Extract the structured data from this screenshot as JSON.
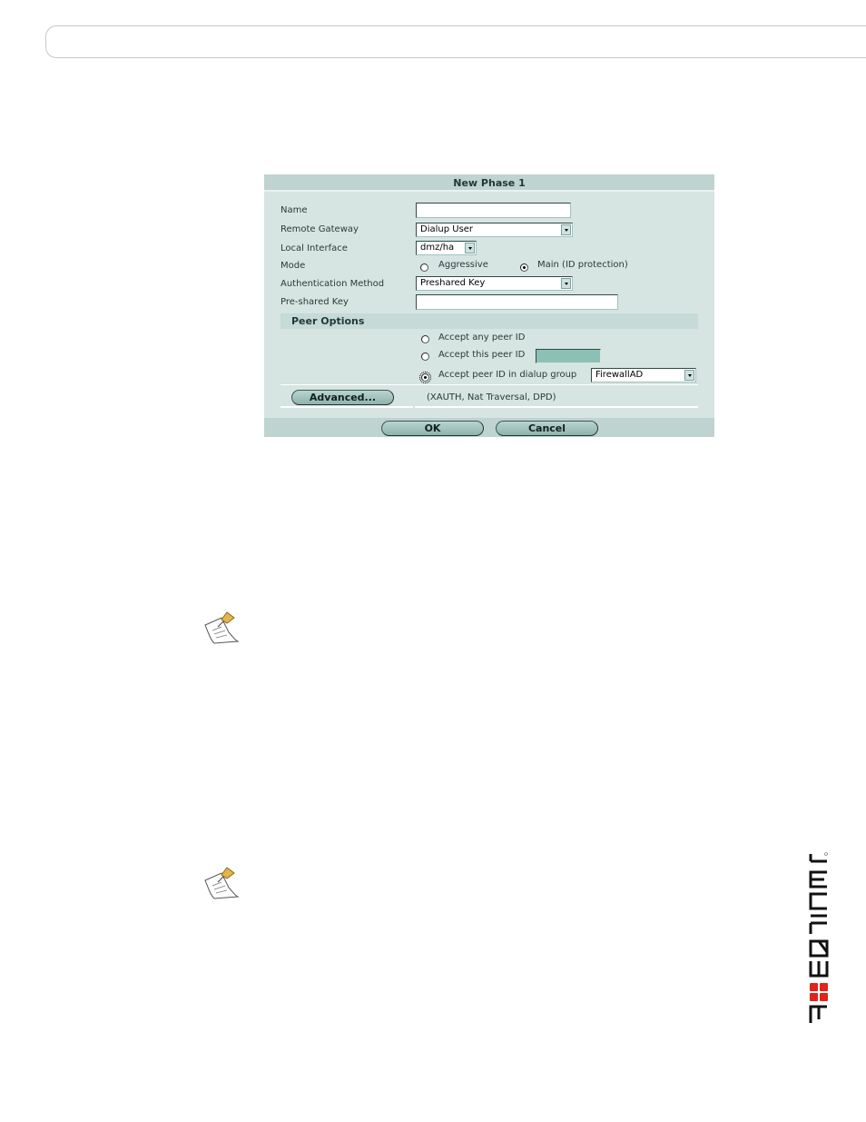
{
  "dialog": {
    "title": "New Phase 1",
    "fields": {
      "name": {
        "label": "Name",
        "value": ""
      },
      "remote_gateway": {
        "label": "Remote Gateway",
        "value": "Dialup User"
      },
      "local_interface": {
        "label": "Local Interface",
        "value": "dmz/ha"
      },
      "mode": {
        "label": "Mode",
        "options": [
          {
            "label": "Aggressive",
            "checked": false
          },
          {
            "label": "Main (ID protection)",
            "checked": true
          }
        ]
      },
      "auth_method": {
        "label": "Authentication Method",
        "value": "Preshared Key"
      },
      "preshared_key": {
        "label": "Pre-shared Key",
        "value": ""
      }
    },
    "peer_options": {
      "heading": "Peer Options",
      "options": [
        {
          "label": "Accept any peer ID",
          "checked": false
        },
        {
          "label": "Accept this peer ID",
          "checked": false,
          "value": ""
        },
        {
          "label": "Accept peer ID in dialup group",
          "checked": true,
          "group": "FirewallAD"
        }
      ]
    },
    "advanced": {
      "button_label": "Advanced...",
      "description": "(XAUTH, Nat Traversal, DPD)"
    },
    "buttons": {
      "ok": "OK",
      "cancel": "Cancel"
    }
  },
  "icons": {
    "note_1": "note-pushpin-icon",
    "note_2": "note-pushpin-icon"
  },
  "brand": {
    "logo_text": "FORTINET",
    "accent": "#e2231a"
  }
}
